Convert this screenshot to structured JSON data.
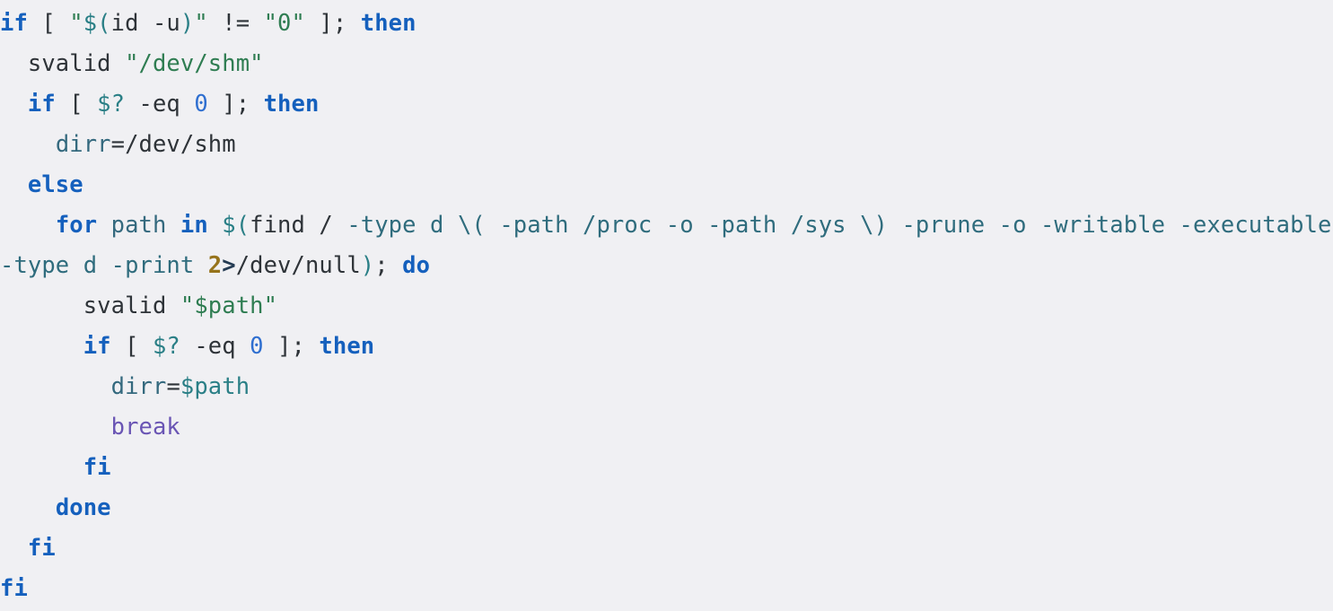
{
  "code_block": {
    "language": "bash",
    "background_color": "#f0f0f3",
    "font": "monospace",
    "colors": {
      "keyword": "#1560bd",
      "string": "#2f7d52",
      "variable": "#2a7f86",
      "variable_name": "#34697e",
      "number": "#2f6fd0",
      "file_descriptor": "#96731b",
      "redirect": "#243b53",
      "flag": "#2f6c7d",
      "builtin": "#6a55b4",
      "plain": "#2e3338"
    },
    "lines": [
      {
        "id": "line-1",
        "indent": "",
        "tokens": [
          {
            "t": "if",
            "c": "kw"
          },
          {
            "t": " ",
            "c": "plain"
          },
          {
            "t": "[",
            "c": "punct"
          },
          {
            "t": " ",
            "c": "plain"
          },
          {
            "t": "\"",
            "c": "str"
          },
          {
            "t": "$(",
            "c": "var"
          },
          {
            "t": "id",
            "c": "plain"
          },
          {
            "t": " ",
            "c": "plain"
          },
          {
            "t": "-u",
            "c": "plain"
          },
          {
            "t": ")",
            "c": "var"
          },
          {
            "t": "\"",
            "c": "str"
          },
          {
            "t": " ",
            "c": "plain"
          },
          {
            "t": "!=",
            "c": "plain"
          },
          {
            "t": " ",
            "c": "plain"
          },
          {
            "t": "\"0\"",
            "c": "str"
          },
          {
            "t": " ",
            "c": "plain"
          },
          {
            "t": "]",
            "c": "punct"
          },
          {
            "t": ";",
            "c": "punct"
          },
          {
            "t": " ",
            "c": "plain"
          },
          {
            "t": "then",
            "c": "kw"
          }
        ]
      },
      {
        "id": "line-2",
        "indent": "  ",
        "tokens": [
          {
            "t": "svalid",
            "c": "plain"
          },
          {
            "t": " ",
            "c": "plain"
          },
          {
            "t": "\"/dev/shm\"",
            "c": "str"
          }
        ]
      },
      {
        "id": "line-3",
        "indent": "  ",
        "tokens": [
          {
            "t": "if",
            "c": "kw"
          },
          {
            "t": " ",
            "c": "plain"
          },
          {
            "t": "[",
            "c": "punct"
          },
          {
            "t": " ",
            "c": "plain"
          },
          {
            "t": "$?",
            "c": "var"
          },
          {
            "t": " ",
            "c": "plain"
          },
          {
            "t": "-eq",
            "c": "plain"
          },
          {
            "t": " ",
            "c": "plain"
          },
          {
            "t": "0",
            "c": "num"
          },
          {
            "t": " ",
            "c": "plain"
          },
          {
            "t": "]",
            "c": "punct"
          },
          {
            "t": ";",
            "c": "punct"
          },
          {
            "t": " ",
            "c": "plain"
          },
          {
            "t": "then",
            "c": "kw"
          }
        ]
      },
      {
        "id": "line-4",
        "indent": "    ",
        "tokens": [
          {
            "t": "dirr",
            "c": "varname"
          },
          {
            "t": "=",
            "c": "plain"
          },
          {
            "t": "/dev/shm",
            "c": "plain"
          }
        ]
      },
      {
        "id": "line-5",
        "indent": "  ",
        "tokens": [
          {
            "t": "else",
            "c": "kw"
          }
        ]
      },
      {
        "id": "line-6",
        "indent": "    ",
        "tokens": [
          {
            "t": "for",
            "c": "kw"
          },
          {
            "t": " ",
            "c": "plain"
          },
          {
            "t": "path",
            "c": "varname"
          },
          {
            "t": " ",
            "c": "plain"
          },
          {
            "t": "in",
            "c": "kw"
          },
          {
            "t": " ",
            "c": "plain"
          },
          {
            "t": "$(",
            "c": "var"
          },
          {
            "t": "find",
            "c": "plain"
          },
          {
            "t": " ",
            "c": "plain"
          },
          {
            "t": "/",
            "c": "plain"
          },
          {
            "t": " ",
            "c": "plain"
          },
          {
            "t": "-type",
            "c": "flag"
          },
          {
            "t": " ",
            "c": "plain"
          },
          {
            "t": "d",
            "c": "flag"
          },
          {
            "t": " ",
            "c": "plain"
          },
          {
            "t": "\\(",
            "c": "flag"
          },
          {
            "t": " ",
            "c": "plain"
          },
          {
            "t": "-path",
            "c": "flag"
          },
          {
            "t": " ",
            "c": "plain"
          },
          {
            "t": "/proc",
            "c": "flag"
          },
          {
            "t": " ",
            "c": "plain"
          },
          {
            "t": "-o",
            "c": "flag"
          },
          {
            "t": " ",
            "c": "plain"
          },
          {
            "t": "-path",
            "c": "flag"
          },
          {
            "t": " ",
            "c": "plain"
          },
          {
            "t": "/sys",
            "c": "flag"
          },
          {
            "t": " ",
            "c": "plain"
          },
          {
            "t": "\\)",
            "c": "flag"
          },
          {
            "t": " ",
            "c": "plain"
          },
          {
            "t": "-prune",
            "c": "flag"
          },
          {
            "t": " ",
            "c": "plain"
          },
          {
            "t": "-o",
            "c": "flag"
          },
          {
            "t": " ",
            "c": "plain"
          },
          {
            "t": "-writable",
            "c": "flag"
          },
          {
            "t": " ",
            "c": "plain"
          },
          {
            "t": "-executable",
            "c": "flag"
          },
          {
            "t": " ",
            "c": "plain"
          },
          {
            "t": "-type",
            "c": "flag"
          },
          {
            "t": " ",
            "c": "plain"
          },
          {
            "t": "d",
            "c": "flag"
          },
          {
            "t": " ",
            "c": "plain"
          },
          {
            "t": "-print",
            "c": "flag"
          },
          {
            "t": " ",
            "c": "plain"
          },
          {
            "t": "2",
            "c": "fd"
          },
          {
            "t": ">",
            "c": "redir"
          },
          {
            "t": "/dev/null",
            "c": "plain"
          },
          {
            "t": ")",
            "c": "var"
          },
          {
            "t": ";",
            "c": "punct"
          },
          {
            "t": " ",
            "c": "plain"
          },
          {
            "t": "do",
            "c": "kw"
          }
        ]
      },
      {
        "id": "line-7",
        "indent": "      ",
        "tokens": [
          {
            "t": "svalid",
            "c": "plain"
          },
          {
            "t": " ",
            "c": "plain"
          },
          {
            "t": "\"",
            "c": "str"
          },
          {
            "t": "$path",
            "c": "str"
          },
          {
            "t": "\"",
            "c": "str"
          }
        ]
      },
      {
        "id": "line-8",
        "indent": "      ",
        "tokens": [
          {
            "t": "if",
            "c": "kw"
          },
          {
            "t": " ",
            "c": "plain"
          },
          {
            "t": "[",
            "c": "punct"
          },
          {
            "t": " ",
            "c": "plain"
          },
          {
            "t": "$?",
            "c": "var"
          },
          {
            "t": " ",
            "c": "plain"
          },
          {
            "t": "-eq",
            "c": "plain"
          },
          {
            "t": " ",
            "c": "plain"
          },
          {
            "t": "0",
            "c": "num"
          },
          {
            "t": " ",
            "c": "plain"
          },
          {
            "t": "]",
            "c": "punct"
          },
          {
            "t": ";",
            "c": "punct"
          },
          {
            "t": " ",
            "c": "plain"
          },
          {
            "t": "then",
            "c": "kw"
          }
        ]
      },
      {
        "id": "line-9",
        "indent": "        ",
        "tokens": [
          {
            "t": "dirr",
            "c": "varname"
          },
          {
            "t": "=",
            "c": "plain"
          },
          {
            "t": "$path",
            "c": "var"
          }
        ]
      },
      {
        "id": "line-10",
        "indent": "        ",
        "tokens": [
          {
            "t": "break",
            "c": "builtin"
          }
        ]
      },
      {
        "id": "line-11",
        "indent": "      ",
        "tokens": [
          {
            "t": "fi",
            "c": "kw"
          }
        ]
      },
      {
        "id": "line-12",
        "indent": "    ",
        "tokens": [
          {
            "t": "done",
            "c": "kw"
          }
        ]
      },
      {
        "id": "line-13",
        "indent": "  ",
        "tokens": [
          {
            "t": "fi",
            "c": "kw"
          }
        ]
      },
      {
        "id": "line-14",
        "indent": "",
        "tokens": [
          {
            "t": "fi",
            "c": "kw"
          }
        ]
      }
    ]
  }
}
